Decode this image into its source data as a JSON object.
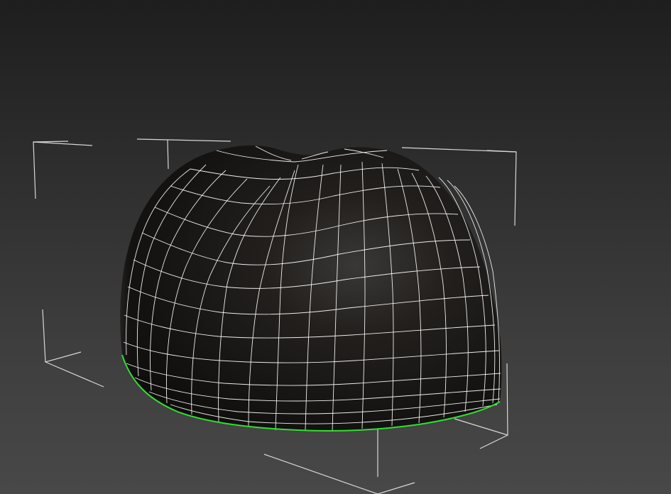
{
  "viewport": {
    "background_top": "#1e1e1e",
    "background_bottom": "#484848"
  },
  "mesh": {
    "shape": "dome with pinched top",
    "fill_color": "#141210",
    "wire_color": "#ffffff",
    "selection_edge_color": "#2fe02f",
    "selected": true
  },
  "selection_brackets": {
    "color": "#d8d8d8"
  }
}
